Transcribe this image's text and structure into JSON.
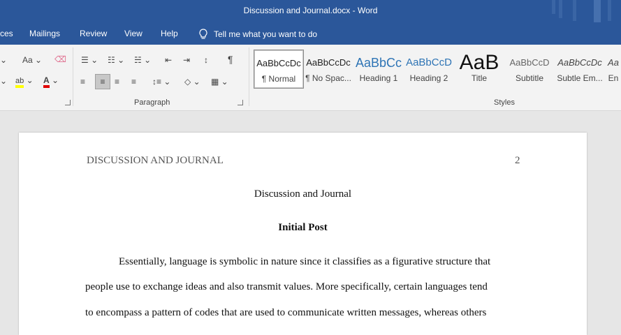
{
  "window": {
    "title": "Discussion and Journal.docx  -  Word"
  },
  "menu": {
    "items": [
      "ces",
      "Mailings",
      "Review",
      "View",
      "Help"
    ],
    "tell_me": "Tell me what you want to do"
  },
  "ribbon": {
    "font_case_label": "Aa",
    "paragraph_label": "Paragraph",
    "pilcrow": "¶",
    "styles_label": "Styles",
    "styles": [
      {
        "sample": "AaBbCcDc",
        "name": "¶ Normal"
      },
      {
        "sample": "AaBbCcDc",
        "name": "¶ No Spac..."
      },
      {
        "sample": "AaBbCc",
        "name": "Heading 1"
      },
      {
        "sample": "AaBbCcD",
        "name": "Heading 2"
      },
      {
        "sample": "AaB",
        "name": "Title"
      },
      {
        "sample": "AaBbCcD",
        "name": "Subtitle"
      },
      {
        "sample": "AaBbCcDc",
        "name": "Subtle Em..."
      },
      {
        "sample": "Aa",
        "name": "En"
      }
    ]
  },
  "document": {
    "header_text": "DISCUSSION AND JOURNAL",
    "page_number": "2",
    "title": "Discussion and Journal",
    "heading": "Initial Post",
    "lines": [
      "Essentially, language is symbolic in nature since it classifies as a figurative structure that",
      "people use to exchange ideas and also transmit values. More specifically, certain languages tend",
      "to encompass a pattern of codes that are used to communicate written messages, whereas others"
    ]
  }
}
